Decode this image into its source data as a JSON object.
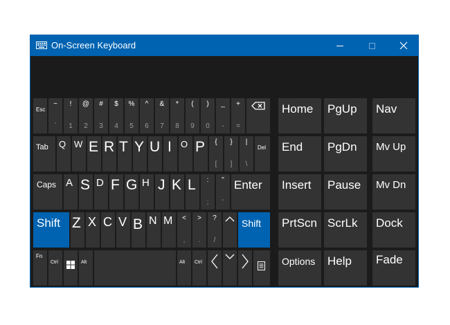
{
  "window": {
    "title": "On-Screen Keyboard"
  },
  "colors": {
    "titlebar": "#0063b1",
    "key": "#333333",
    "key_active": "#0063b1",
    "background": "#1b1b1b",
    "text": "#ffffff"
  },
  "keyboard": {
    "row1": {
      "esc": "Esc",
      "keys": [
        {
          "top": "~",
          "bottom": "`"
        },
        {
          "top": "!",
          "bottom": "1"
        },
        {
          "top": "@",
          "bottom": "2"
        },
        {
          "top": "#",
          "bottom": "3"
        },
        {
          "top": "$",
          "bottom": "4"
        },
        {
          "top": "%",
          "bottom": "5"
        },
        {
          "top": "^",
          "bottom": "6"
        },
        {
          "top": "&",
          "bottom": "7"
        },
        {
          "top": "*",
          "bottom": "8"
        },
        {
          "top": "(",
          "bottom": "9"
        },
        {
          "top": ")",
          "bottom": "0"
        },
        {
          "top": "_",
          "bottom": "-"
        },
        {
          "top": "+",
          "bottom": "="
        }
      ],
      "backspace_icon": "backspace-icon"
    },
    "row2": {
      "tab": "Tab",
      "letters": [
        "Q",
        "W",
        "E",
        "R",
        "T",
        "Y",
        "U",
        "I",
        "O",
        "P"
      ],
      "brackets": [
        {
          "top": "{",
          "bottom": "["
        },
        {
          "top": "}",
          "bottom": "]"
        },
        {
          "top": "|",
          "bottom": "\\"
        }
      ],
      "del": "Del"
    },
    "row3": {
      "caps": "Caps",
      "letters": [
        "A",
        "S",
        "D",
        "F",
        "G",
        "H",
        "J",
        "K",
        "L"
      ],
      "punct": [
        {
          "top": ":",
          "bottom": ";"
        },
        {
          "top": "\"",
          "bottom": "'"
        }
      ],
      "enter": "Enter"
    },
    "row4": {
      "shift_left": "Shift",
      "letters": [
        "Z",
        "X",
        "C",
        "V",
        "B",
        "N",
        "M"
      ],
      "punct": [
        {
          "top": "<",
          "bottom": ","
        },
        {
          "top": ">",
          "bottom": "."
        },
        {
          "top": "?",
          "bottom": "/"
        }
      ],
      "up_arrow": "^",
      "shift_right": "Shift"
    },
    "row5": {
      "fn": "Fn",
      "ctrl_left": "Ctrl",
      "windows_icon": "windows-logo-icon",
      "alt_left": "Alt",
      "alt_right": "Alt",
      "ctrl_right": "Ctrl",
      "left_arrow": "<",
      "down_arrow": "v",
      "right_arrow": ">",
      "menu_icon": "context-menu-icon"
    }
  },
  "side_keys": {
    "row1": [
      "Home",
      "PgUp",
      "Nav"
    ],
    "row2": [
      "End",
      "PgDn",
      "Mv Up"
    ],
    "row3": [
      "Insert",
      "Pause",
      "Mv Dn"
    ],
    "row4": [
      "PrtScn",
      "ScrLk",
      "Dock"
    ],
    "row5": [
      "Options",
      "Help",
      "Fade"
    ]
  }
}
